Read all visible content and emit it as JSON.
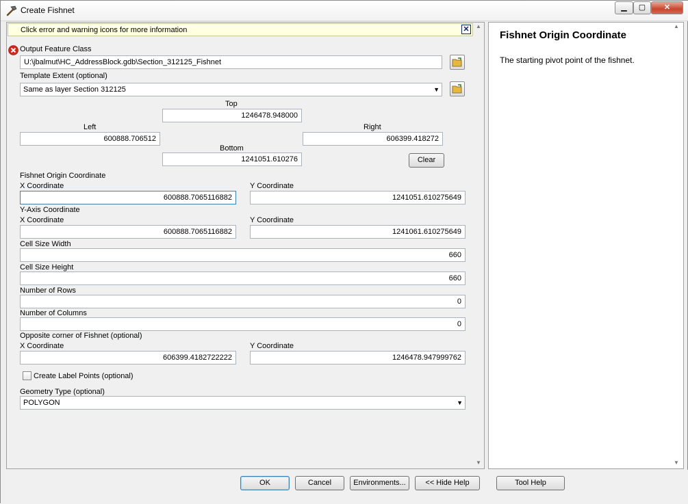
{
  "window": {
    "title": "Create Fishnet"
  },
  "info_bar": {
    "text": "Click error and warning icons for more information",
    "close": "✕"
  },
  "output": {
    "label": "Output Feature Class",
    "value": "U:\\jbalmut\\HC_AddressBlock.gdb\\Section_312125_Fishnet"
  },
  "template": {
    "label": "Template Extent (optional)",
    "value": "Same as layer Section 312125"
  },
  "extent": {
    "top_label": "Top",
    "top": "1246478.948000",
    "left_label": "Left",
    "left": "600888.706512",
    "right_label": "Right",
    "right": "606399.418272",
    "bottom_label": "Bottom",
    "bottom": "1241051.610276",
    "clear": "Clear"
  },
  "origin": {
    "label": "Fishnet Origin Coordinate",
    "x_label": "X Coordinate",
    "x": "600888.7065116882",
    "y_label": "Y Coordinate",
    "y": "1241051.610275649"
  },
  "yaxis": {
    "label": "Y-Axis Coordinate",
    "x_label": "X Coordinate",
    "x": "600888.7065116882",
    "y_label": "Y Coordinate",
    "y": "1241061.610275649"
  },
  "cell_width": {
    "label": "Cell Size Width",
    "value": "660"
  },
  "cell_height": {
    "label": "Cell Size Height",
    "value": "660"
  },
  "rows": {
    "label": "Number of Rows",
    "value": "0"
  },
  "columns": {
    "label": "Number of Columns",
    "value": "0"
  },
  "opposite": {
    "label": "Opposite corner of Fishnet (optional)",
    "x_label": "X Coordinate",
    "x": "606399.4182722222",
    "y_label": "Y Coordinate",
    "y": "1246478.947999762"
  },
  "label_points": {
    "label": "Create Label Points (optional)"
  },
  "geometry": {
    "label": "Geometry Type (optional)",
    "value": "POLYGON"
  },
  "buttons": {
    "ok": "OK",
    "cancel": "Cancel",
    "environments": "Environments...",
    "hide_help": "<< Hide Help",
    "tool_help": "Tool Help"
  },
  "help": {
    "title": "Fishnet Origin Coordinate",
    "body": "The starting pivot point of the fishnet."
  },
  "colors": {
    "error": "#d9241c",
    "info_bg": "#ffffe1",
    "focus": "#3c7fb1"
  }
}
